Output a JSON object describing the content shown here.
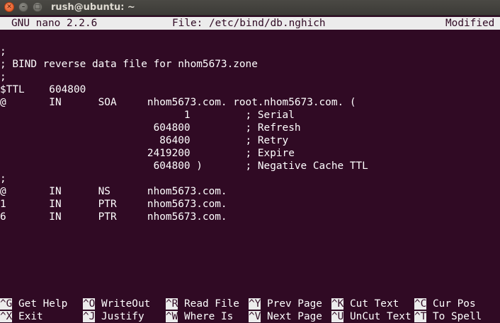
{
  "window": {
    "title": "rush@ubuntu: ~",
    "buttons": {
      "close": "✕",
      "minimize": "–",
      "maximize": "□"
    }
  },
  "nano": {
    "app": "GNU nano 2.2.6",
    "file": "File: /etc/bind/db.nghich",
    "status": "Modified"
  },
  "lines": [
    ";",
    "; BIND reverse data file for nhom5673.zone",
    ";",
    "$TTL    604800",
    "@       IN      SOA     nhom5673.com. root.nhom5673.com. (",
    "                              1         ; Serial",
    "                         604800         ; Refresh",
    "                          86400         ; Retry",
    "                        2419200         ; Expire",
    "                         604800 )       ; Negative Cache TTL",
    ";",
    "@       IN      NS      nhom5673.com.",
    "1       IN      PTR     nhom5673.com.",
    "6       IN      PTR     nhom5673.com."
  ],
  "shortcuts": [
    [
      {
        "key": "^G",
        "label": " Get Help"
      },
      {
        "key": "^O",
        "label": " WriteOut"
      },
      {
        "key": "^R",
        "label": " Read File"
      },
      {
        "key": "^Y",
        "label": " Prev Page"
      },
      {
        "key": "^K",
        "label": " Cut Text"
      },
      {
        "key": "^C",
        "label": " Cur Pos"
      }
    ],
    [
      {
        "key": "^X",
        "label": " Exit"
      },
      {
        "key": "^J",
        "label": " Justify"
      },
      {
        "key": "^W",
        "label": " Where Is"
      },
      {
        "key": "^V",
        "label": " Next Page"
      },
      {
        "key": "^U",
        "label": " UnCut Text"
      },
      {
        "key": "^T",
        "label": " To Spell"
      }
    ]
  ]
}
